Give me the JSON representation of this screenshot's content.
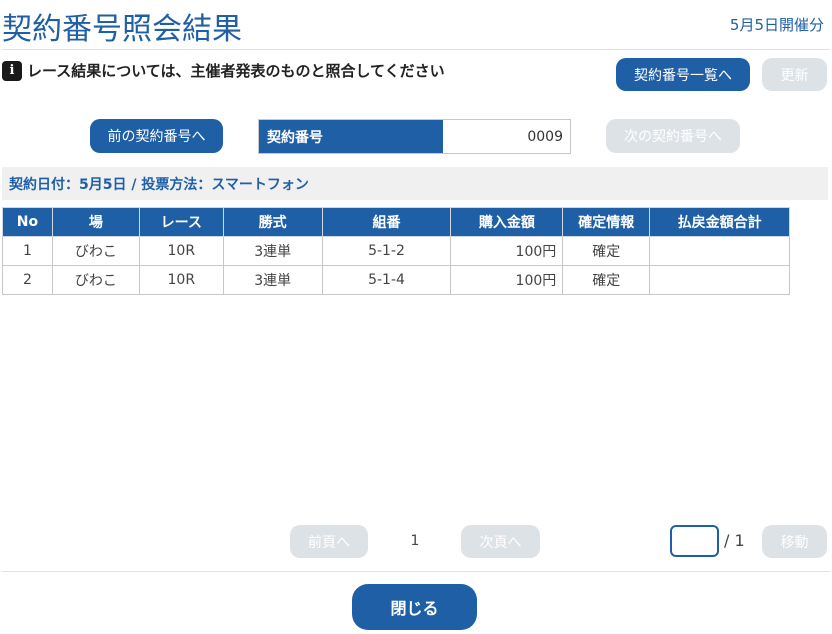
{
  "header": {
    "title": "契約番号照会結果",
    "date_label": "5月5日開催分"
  },
  "notice": {
    "icon": "info-icon",
    "icon_glyph": "i",
    "text": "レース結果については、主催者発表のものと照合してください"
  },
  "toolbar": {
    "contract_list_label": "契約番号一覧へ",
    "refresh_label": "更新"
  },
  "contract_nav": {
    "prev_label": "前の契約番号へ",
    "next_label": "次の契約番号へ",
    "field_label": "契約番号",
    "field_value": "0009"
  },
  "info_bar": {
    "text": "契約日付：5月5日 / 投票方法：スマートフォン"
  },
  "table": {
    "headers": [
      "No",
      "場",
      "レース",
      "勝式",
      "組番",
      "購入金額",
      "確定情報",
      "払戻金額合計"
    ],
    "rows": [
      [
        "1",
        "びわこ",
        "10R",
        "3連単",
        "5-1-2",
        "100円",
        "確定",
        ""
      ],
      [
        "2",
        "びわこ",
        "10R",
        "3連単",
        "5-1-4",
        "100円",
        "確定",
        ""
      ]
    ]
  },
  "pagination": {
    "prev_label": "前頁へ",
    "next_label": "次頁へ",
    "current_page": "1",
    "page_input_value": "",
    "total_label": "/ 1",
    "move_label": "移動"
  },
  "footer": {
    "close_label": "閉じる"
  },
  "colors": {
    "primary": "#1f5fa6",
    "disabled": "#dde2e7",
    "info_bar_bg": "#f0f0f0"
  }
}
